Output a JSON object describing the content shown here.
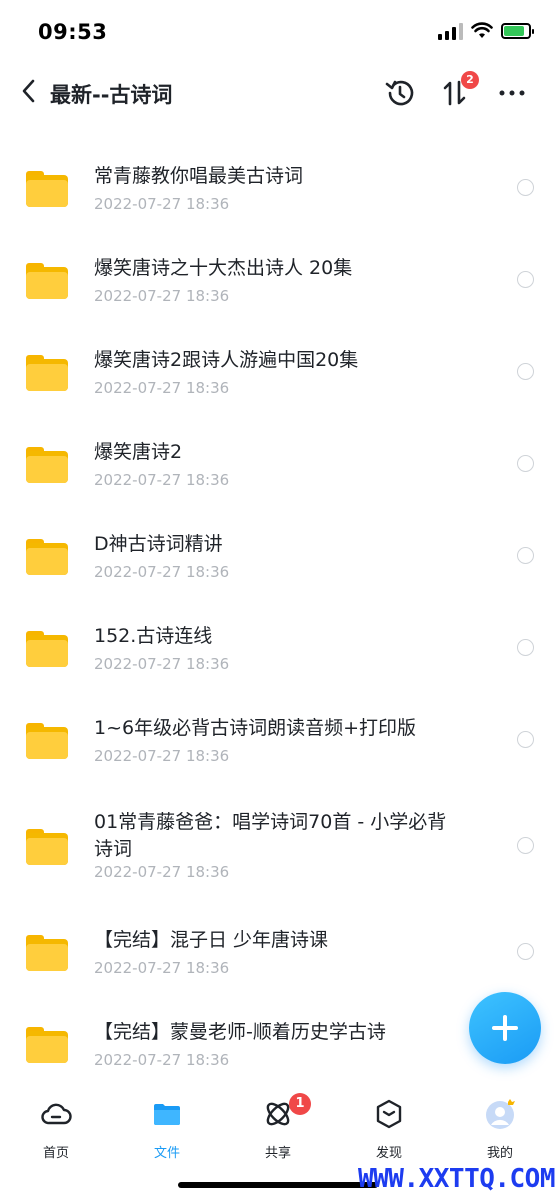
{
  "status_bar": {
    "time": "09:53"
  },
  "header": {
    "title": "最新--古诗词",
    "sort_badge": "2"
  },
  "files": [
    {
      "name": "常青藤教你唱最美古诗词",
      "date": "2022-07-27 18:36"
    },
    {
      "name": "爆笑唐诗之十大杰出诗人 20集",
      "date": "2022-07-27 18:36"
    },
    {
      "name": "爆笑唐诗2跟诗人游遍中国20集",
      "date": "2022-07-27 18:36"
    },
    {
      "name": "爆笑唐诗2",
      "date": "2022-07-27 18:36"
    },
    {
      "name": "D神古诗词精讲",
      "date": "2022-07-27 18:36"
    },
    {
      "name": "152.古诗连线",
      "date": "2022-07-27 18:36"
    },
    {
      "name": "1~6年级必背古诗词朗读音频+打印版",
      "date": "2022-07-27 18:36"
    },
    {
      "name": "01常青藤爸爸：唱学诗词70首 - 小学必背诗词",
      "date": "2022-07-27 18:36"
    },
    {
      "name": "【完结】混子日 少年唐诗课",
      "date": "2022-07-27 18:36"
    },
    {
      "name": "【完结】蒙曼老师-顺着历史学古诗",
      "date": "2022-07-27 18:36"
    }
  ],
  "bottom_nav": {
    "items": [
      {
        "label": "首页",
        "icon": "cloud-icon"
      },
      {
        "label": "文件",
        "icon": "folder-icon"
      },
      {
        "label": "共享",
        "icon": "orbit-icon"
      },
      {
        "label": "发现",
        "icon": "cube-icon"
      },
      {
        "label": "我的",
        "icon": "avatar-icon"
      }
    ],
    "active": "文件",
    "share_badge": "1"
  },
  "watermark": "WWW.XXTTQ.COM",
  "colors": {
    "accent": "#1a9bf5",
    "badge": "#f04848",
    "folder": "#ffce3d"
  }
}
